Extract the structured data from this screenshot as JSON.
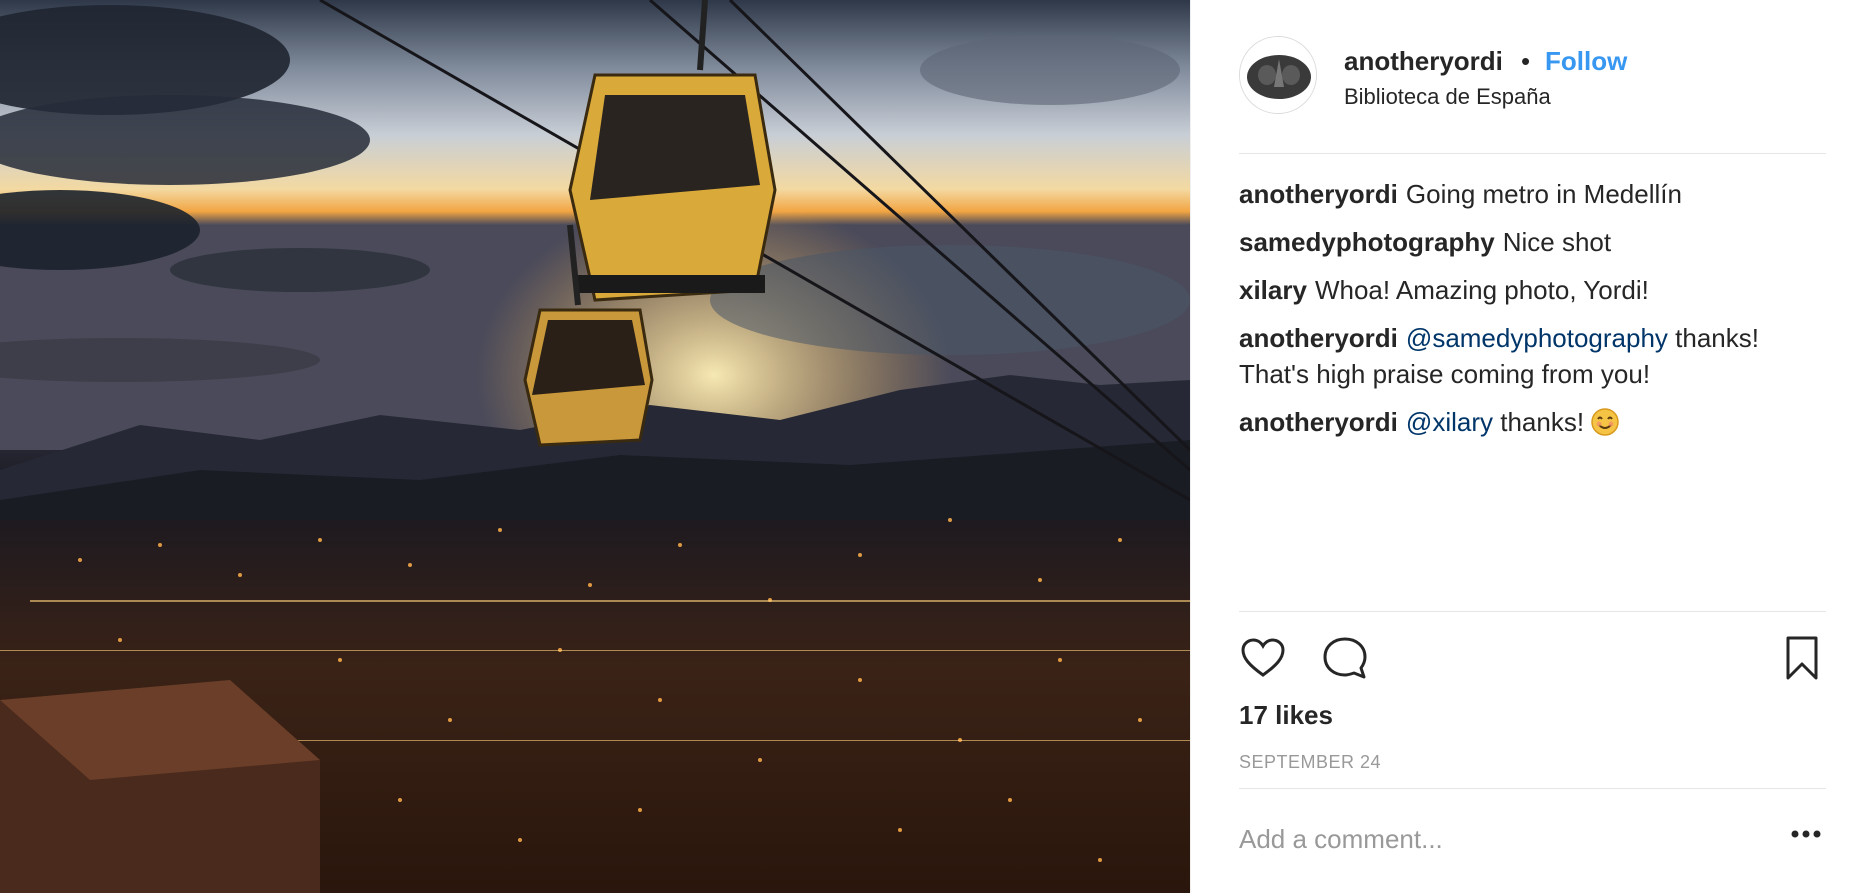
{
  "photo": {
    "description_icon": "photo"
  },
  "header": {
    "username": "anotheryordi",
    "separator": "•",
    "follow_label": "Follow",
    "location": "Biblioteca de España"
  },
  "comments": [
    {
      "author": "anotheryordi",
      "text": "Going metro in Medellín"
    },
    {
      "author": "samedyphotography",
      "text": "Nice shot"
    },
    {
      "author": "xilary",
      "text": "Whoa! Amazing photo, Yordi!"
    },
    {
      "author": "anotheryordi",
      "mention": "@samedyphotography",
      "text": " thanks! That's high praise coming from you!"
    },
    {
      "author": "anotheryordi",
      "mention": "@xilary",
      "text": " thanks!",
      "emoji": "smiling-face-emoji"
    }
  ],
  "actions": {
    "like_icon": "heart-icon",
    "comment_icon": "comment-bubble-icon",
    "save_icon": "bookmark-icon",
    "likes": "17 likes",
    "date": "SEPTEMBER 24"
  },
  "comment_box": {
    "placeholder": "Add a comment...",
    "more_icon": "more-options-icon"
  },
  "colors": {
    "follow": "#3897f0",
    "mention": "#003569",
    "muted": "#999999",
    "text": "#262626"
  }
}
